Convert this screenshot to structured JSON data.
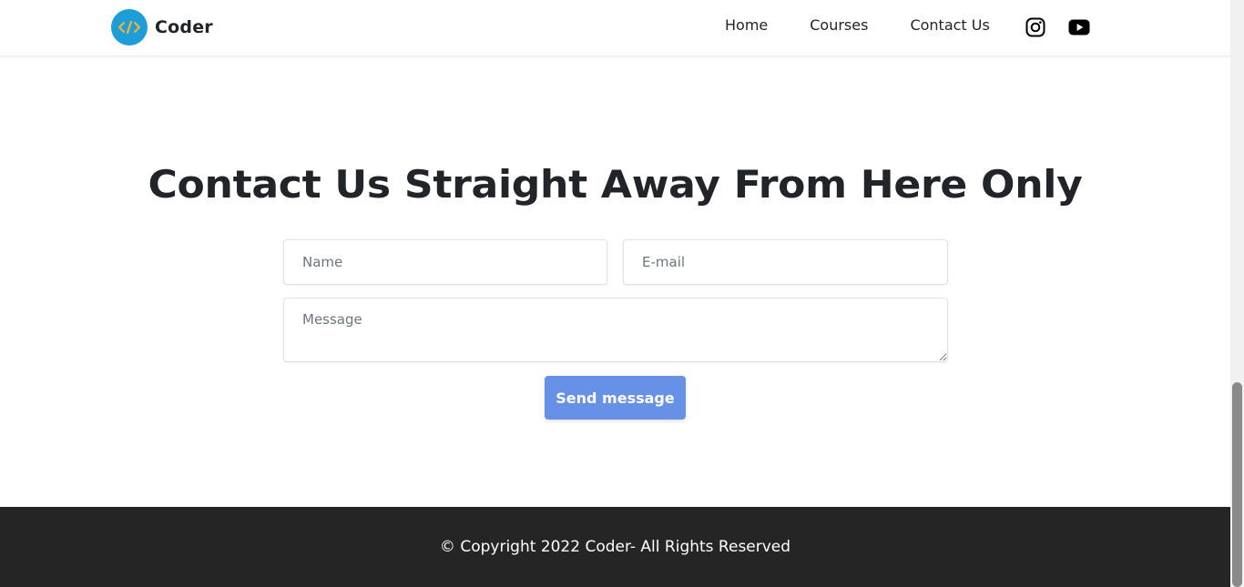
{
  "navbar": {
    "brand_name": "Coder",
    "links": [
      {
        "label": "Home"
      },
      {
        "label": "Courses"
      },
      {
        "label": "Contact Us"
      }
    ],
    "social": [
      "instagram-icon",
      "youtube-icon"
    ]
  },
  "contact": {
    "title": "Contact Us Straight Away From Here Only",
    "name_placeholder": "Name",
    "email_placeholder": "E-mail",
    "message_placeholder": "Message",
    "send_label": "Send message"
  },
  "footer": {
    "copyright": "© Copyright 2022 Coder- All Rights Reserved"
  },
  "colors": {
    "accent_button": "#6691e6",
    "logo_bg": "#1e9ed9",
    "footer_bg": "#252525",
    "text": "#212529"
  }
}
